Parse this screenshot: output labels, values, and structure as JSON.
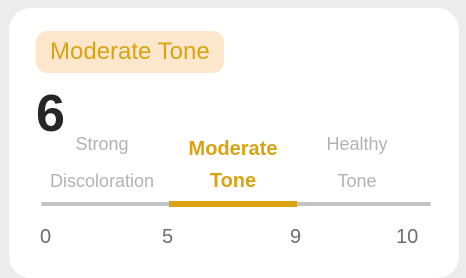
{
  "badge": {
    "label": "Moderate Tone"
  },
  "score": {
    "value": "6"
  },
  "categories": [
    {
      "line1": "Strong",
      "line2": "Discoloration"
    },
    {
      "line1": "Moderate",
      "line2": "Tone"
    },
    {
      "line1": "Healthy",
      "line2": "Tone"
    }
  ],
  "scale": {
    "ticks": [
      "0",
      "5",
      "9",
      "10"
    ],
    "active_range": [
      5,
      9
    ],
    "min": 0,
    "max": 10
  },
  "colors": {
    "accent": "#d8a412",
    "badge_bg": "#fde7cc",
    "track": "#c3c3c3",
    "muted_text": "#b3b3b3",
    "score_text": "#262626"
  }
}
